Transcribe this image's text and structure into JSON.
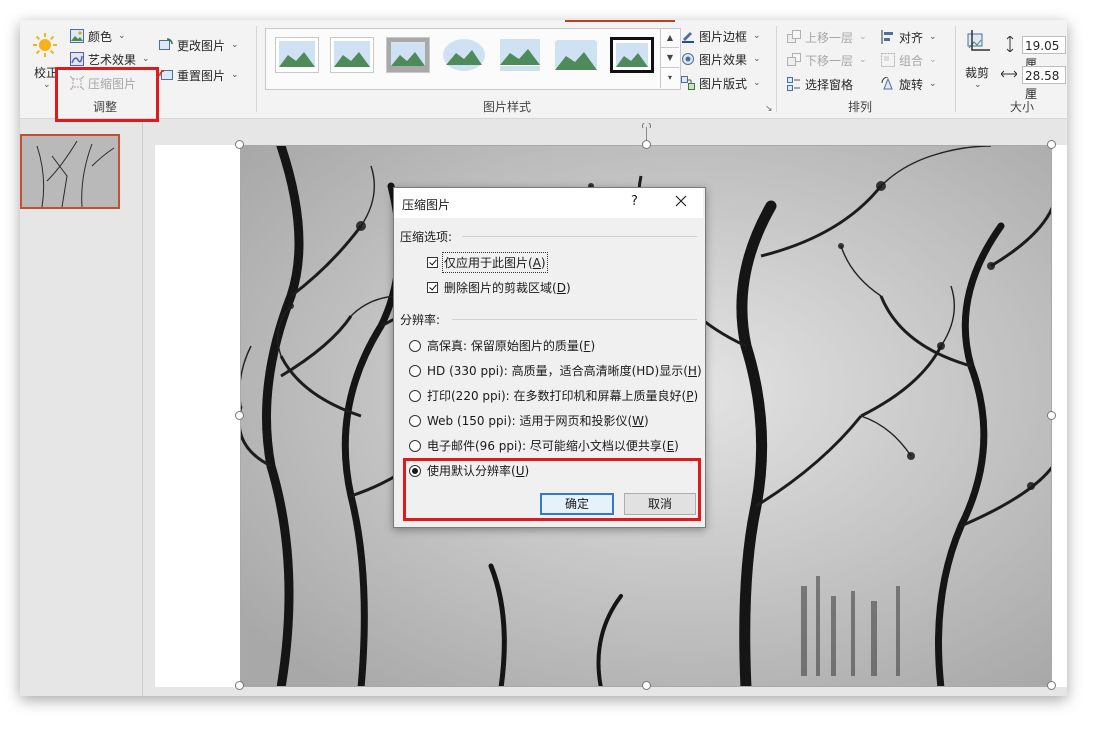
{
  "ribbon": {
    "adjust": {
      "corrections_label": "校正",
      "color_label": "颜色",
      "artistic_effects_label": "艺术效果",
      "compress_pictures_label": "压缩图片",
      "change_picture_label": "更改图片",
      "reset_picture_label": "重置图片",
      "group_label": "调整"
    },
    "picture_styles": {
      "border_label": "图片边框",
      "effects_label": "图片效果",
      "layout_label": "图片版式",
      "group_label": "图片样式"
    },
    "arrange": {
      "bring_forward_label": "上移一层",
      "send_backward_label": "下移一层",
      "selection_pane_label": "选择窗格",
      "align_label": "对齐",
      "group_label_btn": "组合",
      "rotate_label": "旋转",
      "group_label": "排列"
    },
    "size": {
      "crop_label": "裁剪",
      "height_value": "19.05 厘",
      "width_value": "28.58 厘",
      "group_label": "大小"
    }
  },
  "dialog": {
    "title": "压缩图片",
    "help_label": "?",
    "compression_options_label": "压缩选项:",
    "apply_only_label": "仅应用于此图片(",
    "apply_only_key": "A",
    "delete_cropped_label": "删除图片的剪裁区域(",
    "delete_cropped_key": "D",
    "resolution_label": "分辨率:",
    "options": [
      {
        "text": "高保真: 保留原始图片的质量(",
        "key": "F",
        "selected": false
      },
      {
        "text": "HD (330 ppi): 高质量，适合高清晰度(HD)显示(",
        "key": "H",
        "selected": false
      },
      {
        "text": "打印(220 ppi): 在多数打印机和屏幕上质量良好(",
        "key": "P",
        "selected": false
      },
      {
        "text": "Web (150 ppi): 适用于网页和投影仪(",
        "key": "W",
        "selected": false
      },
      {
        "text": "电子邮件(96 ppi): 尽可能缩小文档以便共享(",
        "key": "E",
        "selected": false
      },
      {
        "text": "使用默认分辨率(",
        "key": "U",
        "selected": true
      }
    ],
    "close_paren": ")",
    "ok_label": "确定",
    "cancel_label": "取消"
  },
  "colors": {
    "highlight_red": "#e0191e",
    "accent_orange": "#c43e1c",
    "default_button_blue": "#3478d6"
  }
}
